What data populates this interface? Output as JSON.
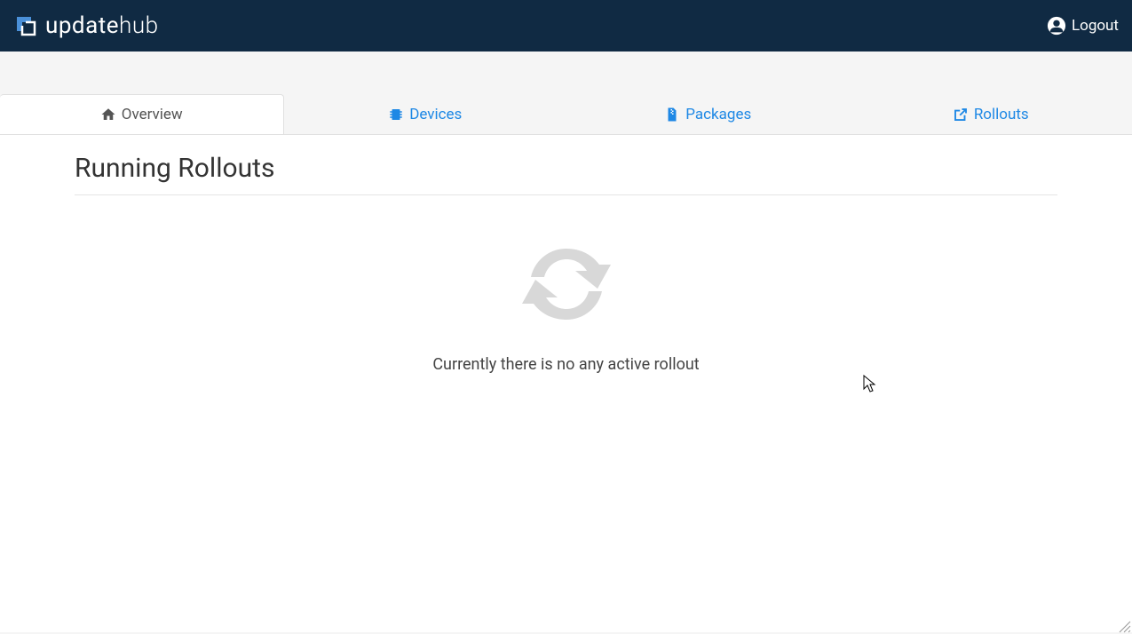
{
  "brand": {
    "name_part1": "update",
    "name_part2": "hub"
  },
  "header": {
    "logout_label": "Logout"
  },
  "tabs": {
    "overview": "Overview",
    "devices": "Devices",
    "packages": "Packages",
    "rollouts": "Rollouts"
  },
  "main": {
    "section_title": "Running Rollouts",
    "empty_message": "Currently there is no any active rollout"
  },
  "colors": {
    "header_bg": "#102a43",
    "accent": "#1e88e5",
    "logo_accent": "#4a90d9"
  }
}
